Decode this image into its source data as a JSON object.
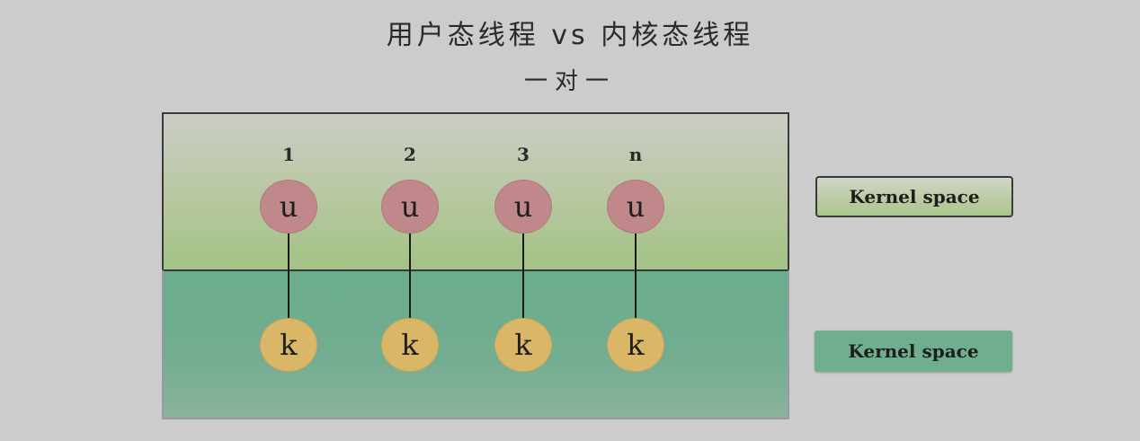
{
  "title": "用户态线程 vs 内核态线程",
  "subtitle": "一对一",
  "regions": {
    "user_space": {
      "color": "#a9c78f"
    },
    "kernel_space": {
      "color": "#6fae8e"
    }
  },
  "legend": {
    "user_box_label": "Kernel space",
    "kernel_box_label": "Kernel space"
  },
  "threads": [
    {
      "label": "1",
      "user_node": "u",
      "kernel_node": "k"
    },
    {
      "label": "2",
      "user_node": "u",
      "kernel_node": "k"
    },
    {
      "label": "3",
      "user_node": "u",
      "kernel_node": "k"
    },
    {
      "label": "n",
      "user_node": "u",
      "kernel_node": "k"
    }
  ],
  "colors": {
    "user_node": "#c0888a",
    "kernel_node": "#d9b766",
    "background": "#cccccc"
  }
}
